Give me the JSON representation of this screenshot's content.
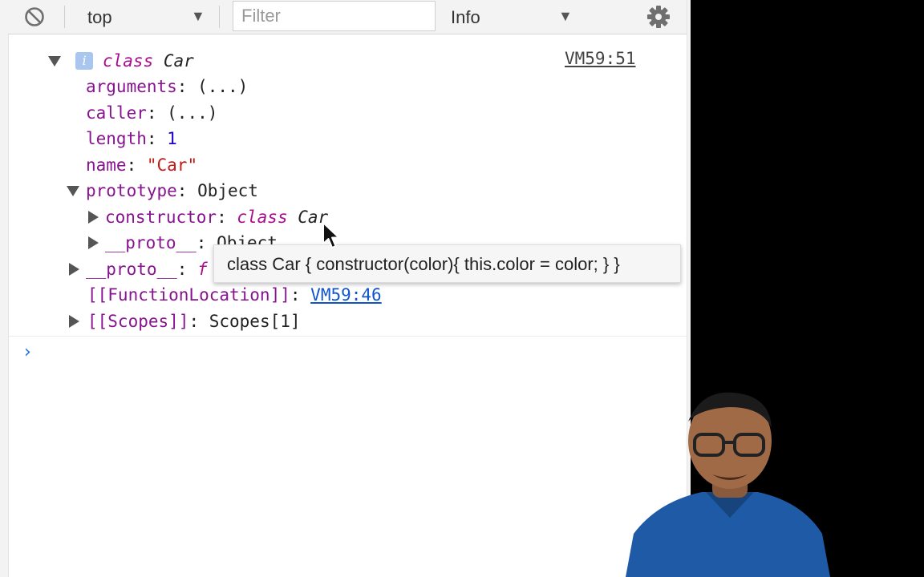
{
  "toolbar": {
    "clear_icon": "clear-console-icon",
    "context": "top",
    "filter_placeholder": "Filter",
    "level": "Info",
    "settings_icon": "gear-icon"
  },
  "console": {
    "source_link": "VM59:51",
    "header": {
      "keyword": "class",
      "name": "Car"
    },
    "props": {
      "arguments": {
        "key": "arguments",
        "value": "(...)"
      },
      "caller": {
        "key": "caller",
        "value": "(...)"
      },
      "length": {
        "key": "length",
        "value": "1"
      },
      "name": {
        "key": "name",
        "value": "\"Car\""
      },
      "prototype": {
        "key": "prototype",
        "value": "Object"
      },
      "constructor": {
        "key": "constructor",
        "keyword": "class",
        "name": "Car"
      },
      "proto_inner": {
        "key": "__proto__",
        "value": "Object"
      },
      "proto_outer": {
        "key": "__proto__",
        "value": "f"
      },
      "function_location": {
        "key": "[[FunctionLocation]]",
        "value": "VM59:46"
      },
      "scopes": {
        "key": "[[Scopes]]",
        "value": "Scopes[1]"
      }
    },
    "prompt": "›"
  },
  "tooltip": {
    "text": "class Car { constructor(color){ this.color = color; } }"
  },
  "colors": {
    "property_key": "#881391",
    "string": "#c41a16",
    "number": "#1c00cf",
    "keyword": "#aa0d91",
    "link": "#1155cc"
  }
}
